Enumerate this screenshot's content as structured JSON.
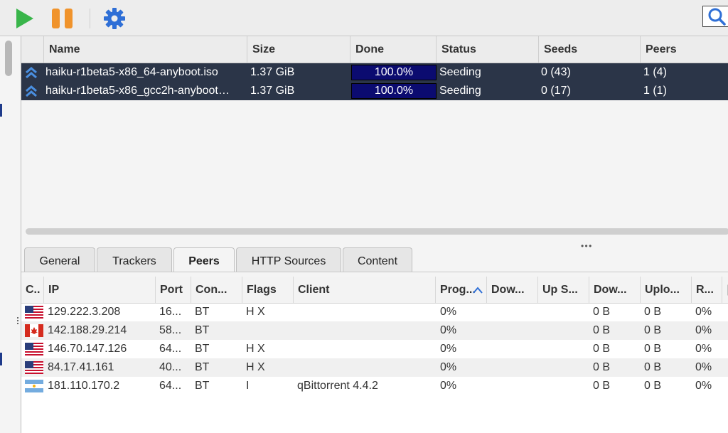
{
  "toolbar": {
    "play_icon": "play-icon",
    "pause_icon": "pause-icon",
    "settings_icon": "gear-icon",
    "search_icon": "search-icon"
  },
  "torrents": {
    "columns": [
      "Name",
      "Size",
      "Done",
      "Status",
      "Seeds",
      "Peers"
    ],
    "rows": [
      {
        "name": "haiku-r1beta5-x86_64-anyboot.iso",
        "size": "1.37 GiB",
        "done": "100.0%",
        "progress": 1.0,
        "status": "Seeding",
        "seeds": "0 (43)",
        "peers": "1 (4)"
      },
      {
        "name": "haiku-r1beta5-x86_gcc2h-anyboot…",
        "size": "1.37 GiB",
        "done": "100.0%",
        "progress": 1.0,
        "status": "Seeding",
        "seeds": "0 (17)",
        "peers": "1 (1)"
      }
    ]
  },
  "tabs": [
    {
      "label": "General"
    },
    {
      "label": "Trackers"
    },
    {
      "label": "Peers",
      "active": true
    },
    {
      "label": "HTTP Sources"
    },
    {
      "label": "Content"
    }
  ],
  "peers": {
    "columns": [
      "C..",
      "IP",
      "Port",
      "Con...",
      "Flags",
      "Client",
      "Prog...",
      "Dow...",
      "Up S...",
      "Dow...",
      "Uplo...",
      "R...",
      "|"
    ],
    "rows": [
      {
        "country": "us",
        "ip": "129.222.3.208",
        "port": "16...",
        "conn": "BT",
        "flags": "H X",
        "client": "",
        "progress": "0%",
        "dl_speed": "",
        "ul_speed": "",
        "downloaded": "0 B",
        "uploaded": "0 B",
        "relevance": "0%"
      },
      {
        "country": "ca",
        "ip": "142.188.29.214",
        "port": "58...",
        "conn": "BT",
        "flags": "",
        "client": "",
        "progress": "0%",
        "dl_speed": "",
        "ul_speed": "",
        "downloaded": "0 B",
        "uploaded": "0 B",
        "relevance": "0%"
      },
      {
        "country": "us",
        "ip": "146.70.147.126",
        "port": "64...",
        "conn": "BT",
        "flags": "H X",
        "client": "",
        "progress": "0%",
        "dl_speed": "",
        "ul_speed": "",
        "downloaded": "0 B",
        "uploaded": "0 B",
        "relevance": "0%"
      },
      {
        "country": "us",
        "ip": "84.17.41.161",
        "port": "40...",
        "conn": "BT",
        "flags": "H X",
        "client": "",
        "progress": "0%",
        "dl_speed": "",
        "ul_speed": "",
        "downloaded": "0 B",
        "uploaded": "0 B",
        "relevance": "0%"
      },
      {
        "country": "ar",
        "ip": "181.110.170.2",
        "port": "64...",
        "conn": "BT",
        "flags": "I",
        "client": "qBittorrent 4.4.2",
        "progress": "0%",
        "dl_speed": "",
        "ul_speed": "",
        "downloaded": "0 B",
        "uploaded": "0 B",
        "relevance": "0%"
      }
    ]
  },
  "colors": {
    "selected_row": "#2b3548",
    "progress_fill": "#0b0b70",
    "accent_blue": "#2f6fd6",
    "play_green": "#39b54a",
    "pause_orange": "#f0932b"
  }
}
